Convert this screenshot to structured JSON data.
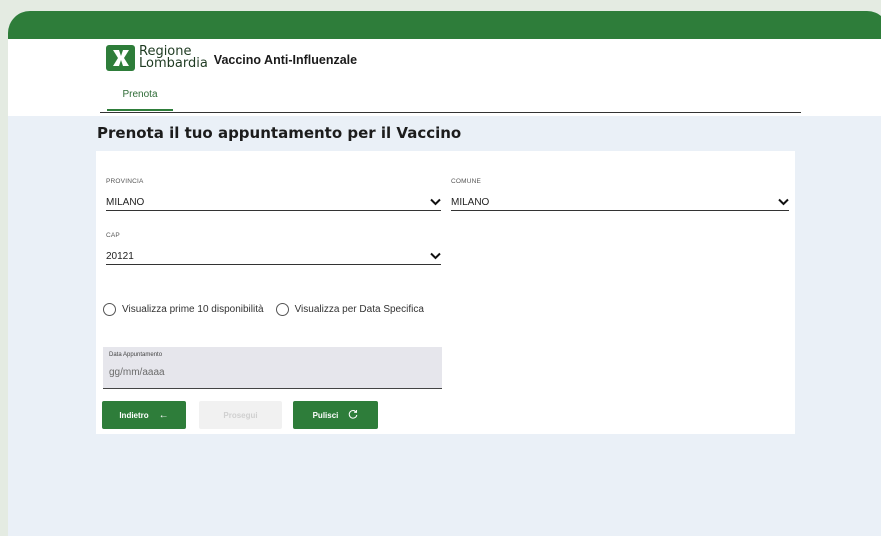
{
  "logo": {
    "line1": "Regione",
    "line2": "Lombardia"
  },
  "app_title": "Vaccino Anti-Influenzale",
  "tabs": [
    {
      "label": "Prenota"
    }
  ],
  "page_title": "Prenota il tuo appuntamento per il Vaccino",
  "form": {
    "provincia": {
      "label": "PROVINCIA",
      "value": "MILANO"
    },
    "comune": {
      "label": "COMUNE",
      "value": "MILANO"
    },
    "cap": {
      "label": "CAP",
      "value": "20121"
    },
    "radio_options": [
      {
        "label": "Visualizza prime 10 disponibilità",
        "selected": false
      },
      {
        "label": "Visualizza per Data Specifica",
        "selected": false
      }
    ],
    "date": {
      "label": "Data Appuntamento",
      "placeholder": "gg/mm/aaaa"
    }
  },
  "buttons": {
    "back": {
      "label": "Indietro",
      "icon": "arrow-left-icon"
    },
    "next": {
      "label": "Prosegui"
    },
    "clear": {
      "label": "Pulisci",
      "icon": "refresh-icon"
    }
  },
  "colors": {
    "brand_green": "#2e7d3a",
    "page_bg": "#eaf0f7"
  }
}
